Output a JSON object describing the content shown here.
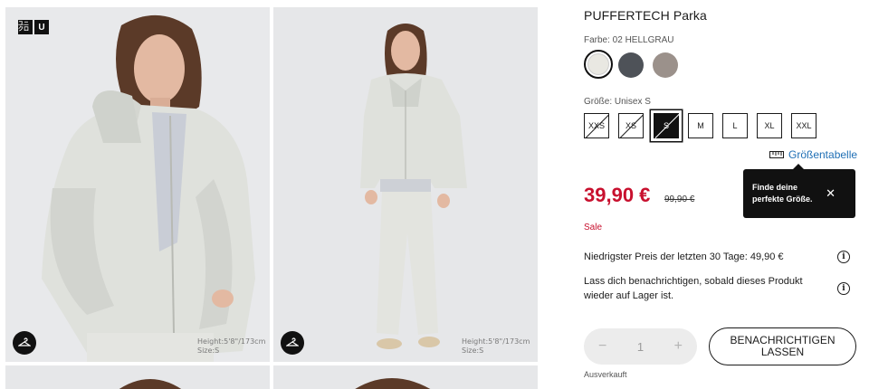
{
  "brand": {
    "logo_top": "ユニ クロ",
    "logo_letter": "U"
  },
  "gallery": {
    "photos": [
      {
        "model_info": "Height:5'8\"/173cm",
        "size_info": "Size:S"
      },
      {
        "model_info": "Height:5'8\"/173cm",
        "size_info": "Size:S"
      }
    ],
    "hanger_icon": "hanger-icon"
  },
  "product": {
    "title": "PUFFERTECH Parka",
    "color_label": "Farbe: 02 HELLGRAU",
    "colors": [
      {
        "name": "02 HELLGRAU",
        "hex": "#e9e8e2",
        "selected": true
      },
      {
        "name": "dark grey",
        "hex": "#4e5258",
        "selected": false
      },
      {
        "name": "taupe",
        "hex": "#9b918b",
        "selected": false
      }
    ],
    "size_label": "Größe: Unisex S",
    "sizes": [
      {
        "label": "XXS",
        "available": false,
        "selected": false
      },
      {
        "label": "XS",
        "available": false,
        "selected": false
      },
      {
        "label": "S",
        "available": false,
        "selected": true
      },
      {
        "label": "M",
        "available": true,
        "selected": false
      },
      {
        "label": "L",
        "available": true,
        "selected": false
      },
      {
        "label": "XL",
        "available": true,
        "selected": false
      },
      {
        "label": "XXL",
        "available": true,
        "selected": false
      }
    ],
    "size_chart_label": "Größentabelle",
    "tooltip": {
      "line1": "Finde deine",
      "line2": "perfekte Größe.",
      "close": "✕"
    },
    "price": "39,90 €",
    "old_price": "99,90 €",
    "sale": "Sale",
    "lowest_price_note": "Niedrigster Preis der letzten 30 Tage: 49,90 €",
    "notify_note": "Lass dich benachrichtigen, sobald dieses Produkt wieder auf Lager ist.",
    "quantity": {
      "minus": "−",
      "value": "1",
      "plus": "+"
    },
    "notify_button": "BENACHRICHTIGEN LASSEN",
    "sold_out": "Ausverkauft"
  },
  "colors": {
    "accent_red": "#c8102e",
    "link_blue": "#1f6fb5"
  }
}
